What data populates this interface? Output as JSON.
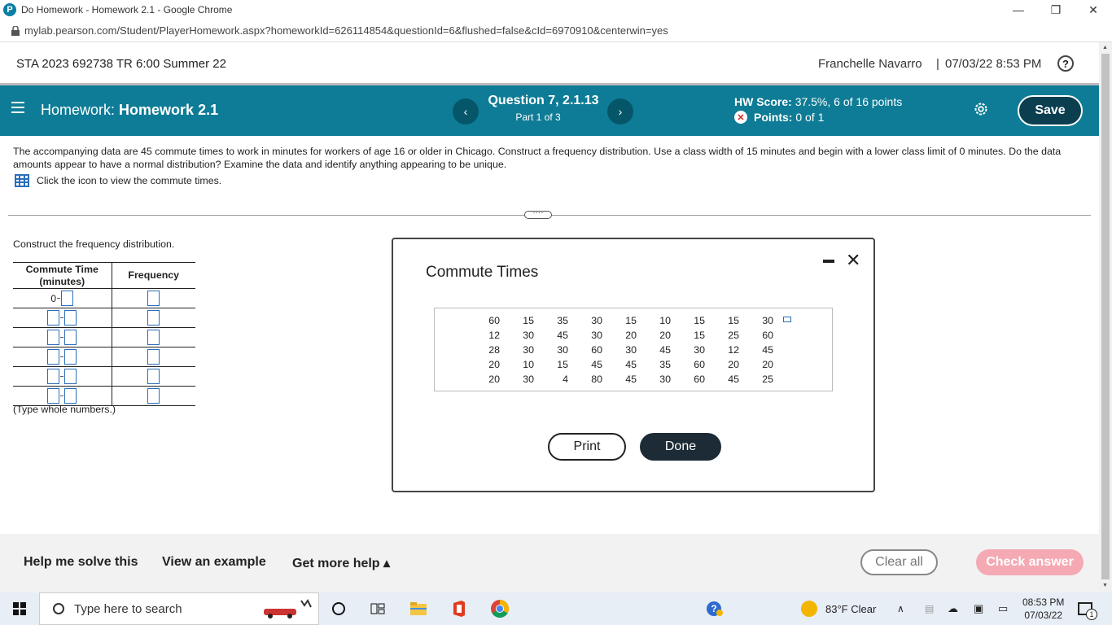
{
  "browser": {
    "tab_title": "Do Homework - Homework 2.1 - Google Chrome",
    "url": "mylab.pearson.com/Student/PlayerHomework.aspx?homeworkId=626114854&questionId=6&flushed=false&cId=6970910&centerwin=yes",
    "minimize": "—",
    "restore": "❐",
    "close": "✕"
  },
  "header": {
    "course": "STA 2023 692738 TR 6:00 Summer 22",
    "user": "Franchelle Navarro",
    "separator": "|",
    "datetime": "07/03/22 8:53 PM",
    "help": "?"
  },
  "hwbar": {
    "label": "Homework:",
    "title": "Homework 2.1",
    "prev": "‹",
    "next": "›",
    "question": "Question 7, 2.1.13",
    "part": "Part 1 of 3",
    "score_label": "HW Score:",
    "score_value": "37.5%, 6 of 16 points",
    "points_label": "Points:",
    "points_value": "0 of 1",
    "save": "Save"
  },
  "question": {
    "text": "The accompanying data are 45 commute times to work in minutes for workers of age 16 or older in Chicago. Construct a frequency distribution. Use a class width of 15 minutes and begin with a lower class limit of 0 minutes. Do the data amounts appear to have a normal distribution? Examine the data and identify anything appearing to be unique.",
    "icon_hint": "Click the icon to view the commute times.",
    "divider_handle": "····"
  },
  "answer": {
    "instruction": "Construct the frequency distribution.",
    "col1_line1": "Commute Time",
    "col1_line2": "(minutes)",
    "col2": "Frequency",
    "first_lower": "0",
    "note": "(Type whole numbers.)"
  },
  "modal": {
    "title": "Commute Times",
    "minimize": "—",
    "close": "✕",
    "data": [
      [
        "60",
        "15",
        "35",
        "30",
        "15",
        "10",
        "15",
        "15",
        "30"
      ],
      [
        "12",
        "30",
        "45",
        "30",
        "20",
        "20",
        "15",
        "25",
        "60"
      ],
      [
        "28",
        "30",
        "30",
        "60",
        "30",
        "45",
        "30",
        "12",
        "45"
      ],
      [
        "20",
        "10",
        "15",
        "45",
        "45",
        "35",
        "60",
        "20",
        "20"
      ],
      [
        "20",
        "30",
        "4",
        "80",
        "45",
        "30",
        "60",
        "45",
        "25"
      ]
    ],
    "print": "Print",
    "done": "Done"
  },
  "footer": {
    "help_solve": "Help me solve this",
    "example": "View an example",
    "more_help": "Get more help ▴",
    "clear_all": "Clear all",
    "check_answer": "Check answer"
  },
  "taskbar": {
    "search_placeholder": "Type here to search",
    "weather": "83°F  Clear",
    "time": "08:53 PM",
    "date": "07/03/22",
    "notif_count": "1"
  }
}
